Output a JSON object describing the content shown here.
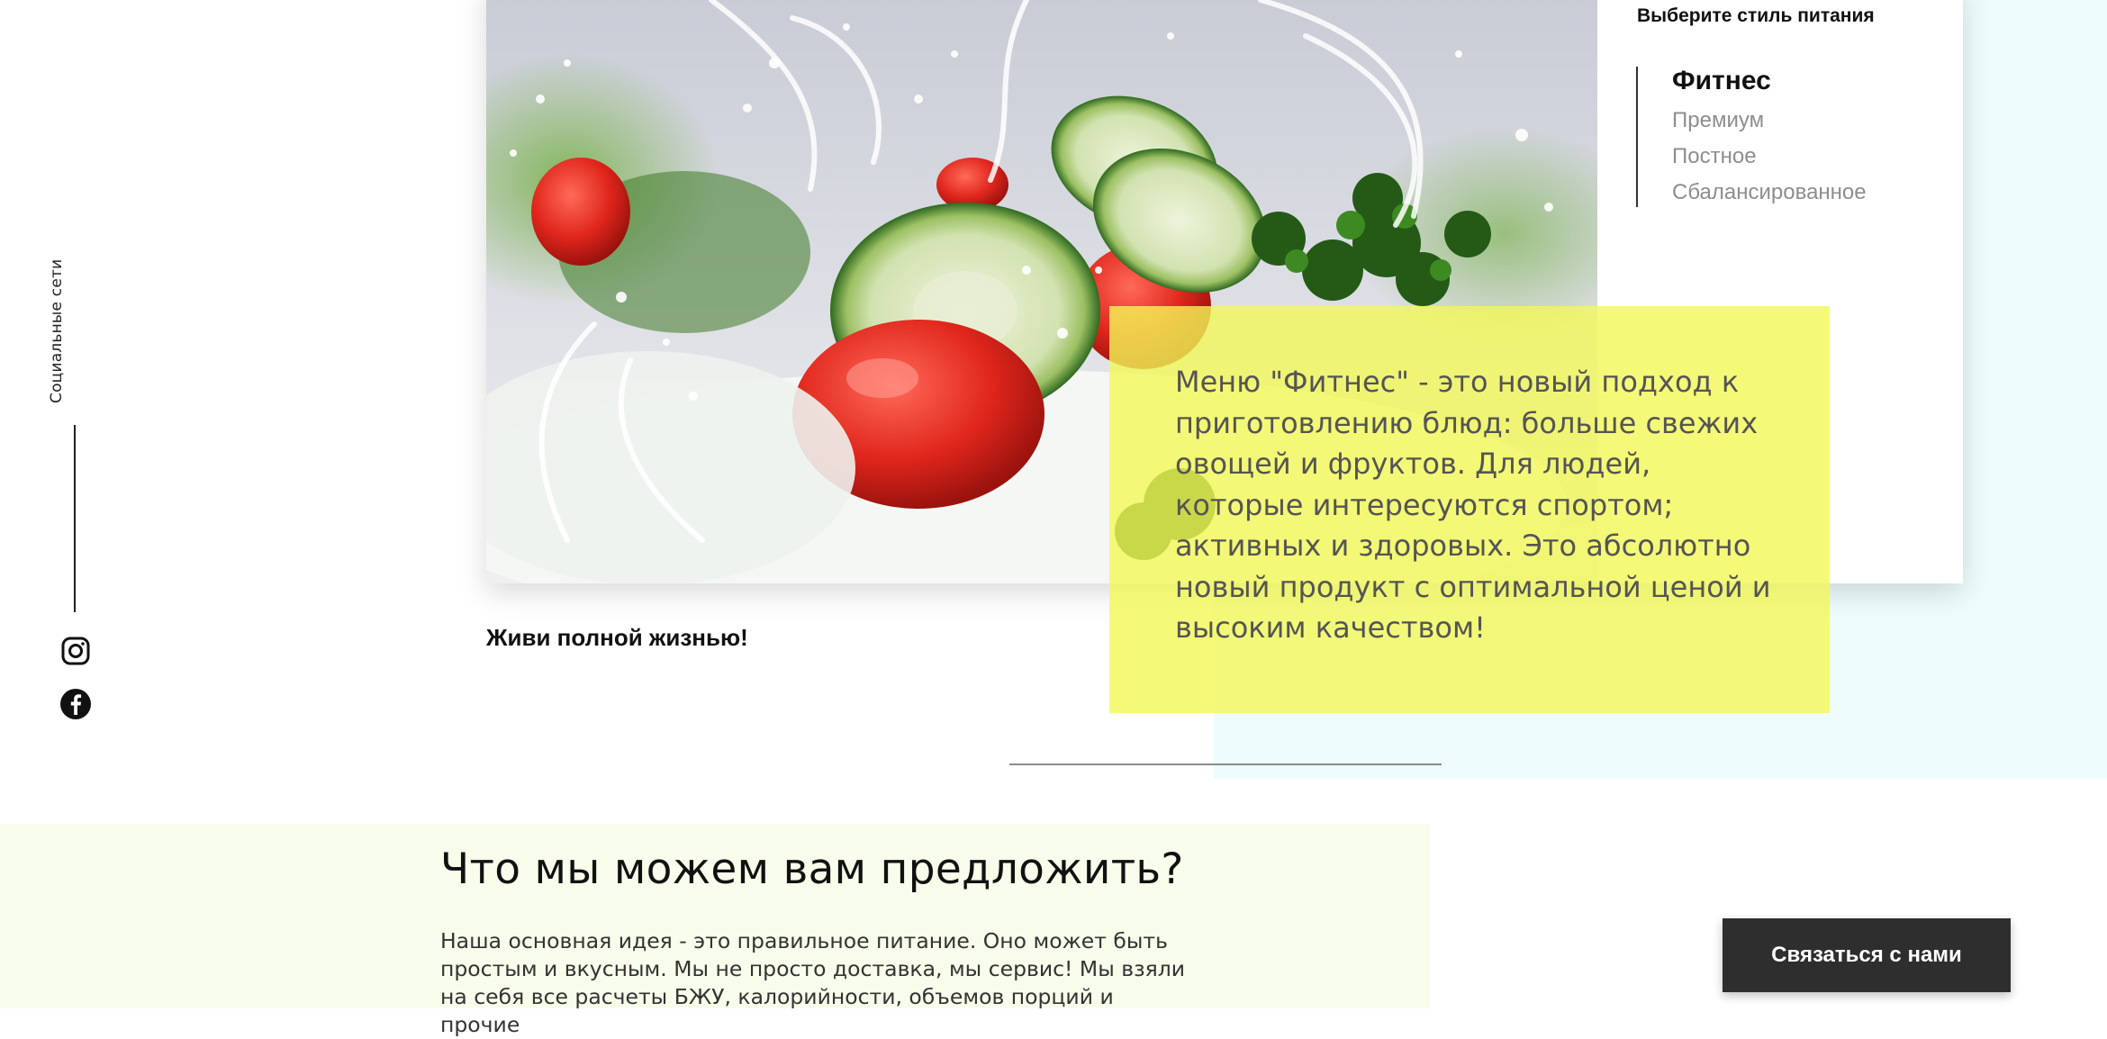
{
  "social": {
    "label": "Социальные сети",
    "icons": [
      "instagram-icon",
      "facebook-icon"
    ]
  },
  "style_selector": {
    "title": "Выберите стиль питания",
    "items": [
      {
        "label": "Фитнес",
        "active": true
      },
      {
        "label": "Премиум",
        "active": false
      },
      {
        "label": "Постное",
        "active": false
      },
      {
        "label": "Сбалансированное",
        "active": false
      }
    ]
  },
  "description": "Меню \"Фитнес\" - это новый подход к приготовлению блюд: больше свежих овощей и фруктов. Для людей, которые интересуются спортом; активных и здоровых. Это абсолютно новый продукт с оптимальной ценой и высоким качеством!",
  "slogan": "Живи полной жизнью!",
  "offer": {
    "title": "Что мы можем вам предложить?",
    "text": "Наша основная идея - это правильное питание. Оно может быть простым и вкусным. Мы не просто доставка, мы сервис! Мы взяли на себя все расчеты БЖУ, калорийности, объемов порций и прочие"
  },
  "contact_button": "Связаться с нами",
  "colors": {
    "accent_yellow": "#f3f856",
    "light_blue": "#eefcfc",
    "light_green": "#f7fdea",
    "button_dark": "#2e2e2e"
  }
}
